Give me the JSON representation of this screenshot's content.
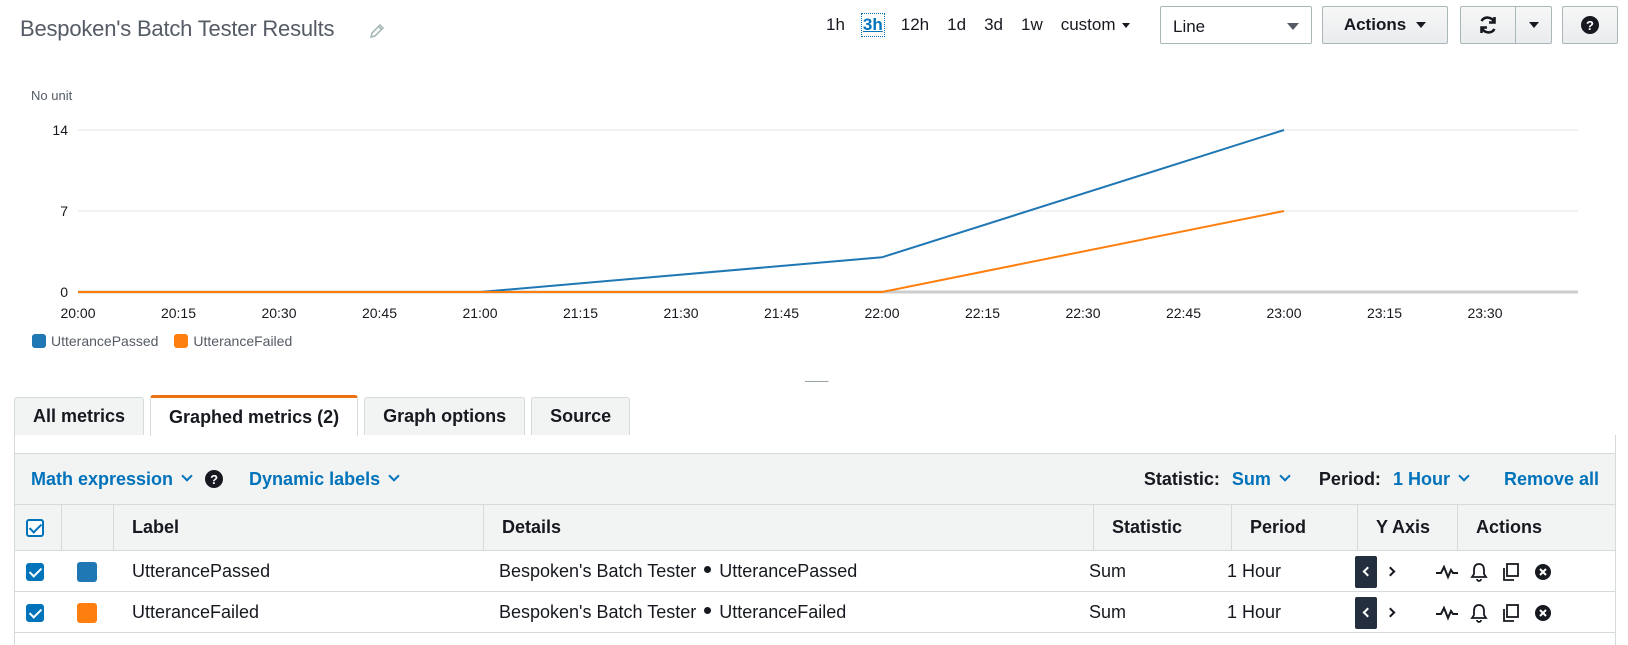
{
  "header": {
    "title": "Bespoken's Batch Tester Results",
    "time_ranges": [
      "1h",
      "3h",
      "12h",
      "1d",
      "3d",
      "1w"
    ],
    "active_range": "3h",
    "custom_label": "custom",
    "chart_type_value": "Line",
    "actions_label": "Actions",
    "help_glyph": "?"
  },
  "chart_data": {
    "type": "line",
    "ylabel": "No unit",
    "yticks": [
      0,
      7,
      14
    ],
    "ylim": [
      0,
      14
    ],
    "x_ticks": [
      "20:00",
      "20:15",
      "20:30",
      "20:45",
      "21:00",
      "21:15",
      "21:30",
      "21:45",
      "22:00",
      "22:15",
      "22:30",
      "22:45",
      "23:00",
      "23:15",
      "23:30"
    ],
    "x": [
      "20:00",
      "21:00",
      "22:00",
      "23:00"
    ],
    "series": [
      {
        "name": "UtterancePassed",
        "color": "#1f77b4",
        "values": [
          0,
          0,
          3,
          14
        ]
      },
      {
        "name": "UtteranceFailed",
        "color": "#ff7f0e",
        "values": [
          0,
          0,
          0,
          7
        ]
      }
    ],
    "legend_position": "bottom-left",
    "grid": true
  },
  "tabs": [
    {
      "label": "All metrics",
      "active": false
    },
    {
      "label": "Graphed metrics (2)",
      "active": true
    },
    {
      "label": "Graph options",
      "active": false
    },
    {
      "label": "Source",
      "active": false
    }
  ],
  "toolbar": {
    "math_expression": "Math expression",
    "dynamic_labels": "Dynamic labels",
    "statistic_label": "Statistic:",
    "statistic_value": "Sum",
    "period_label": "Period:",
    "period_value": "1 Hour",
    "remove_all": "Remove all"
  },
  "table": {
    "headers": {
      "label": "Label",
      "details": "Details",
      "statistic": "Statistic",
      "period": "Period",
      "y_axis": "Y Axis",
      "actions": "Actions"
    },
    "rows": [
      {
        "color": "#1f77b4",
        "label": "UtterancePassed",
        "namespace": "Bespoken's Batch Tester",
        "metric": "UtterancePassed",
        "statistic": "Sum",
        "period": "1 Hour"
      },
      {
        "color": "#ff7f0e",
        "label": "UtteranceFailed",
        "namespace": "Bespoken's Batch Tester",
        "metric": "UtteranceFailed",
        "statistic": "Sum",
        "period": "1 Hour"
      }
    ]
  },
  "icons": [
    "pencil-icon",
    "refresh-icon",
    "help-icon",
    "chevron-down-icon",
    "math-icon",
    "bell-icon",
    "copy-icon",
    "close-circle-icon"
  ]
}
